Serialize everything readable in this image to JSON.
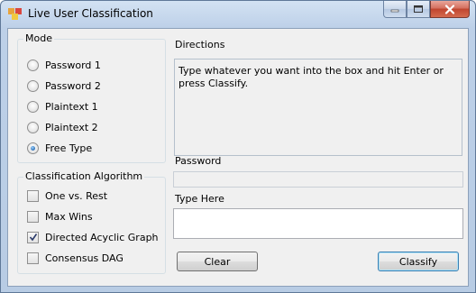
{
  "window": {
    "title": "Live User Classification",
    "title_icon": "app-icon",
    "caption_buttons": [
      "minimize",
      "maximize",
      "close"
    ]
  },
  "mode": {
    "heading": "Mode",
    "options": [
      {
        "label": "Password 1",
        "checked": false
      },
      {
        "label": "Password 2",
        "checked": false
      },
      {
        "label": "Plaintext 1",
        "checked": false
      },
      {
        "label": "Plaintext 2",
        "checked": false
      },
      {
        "label": "Free Type",
        "checked": true
      }
    ]
  },
  "algorithm": {
    "heading": "Classification Algorithm",
    "options": [
      {
        "label": "One vs. Rest",
        "checked": false
      },
      {
        "label": "Max Wins",
        "checked": false
      },
      {
        "label": "Directed Acyclic Graph",
        "checked": true
      },
      {
        "label": "Consensus DAG",
        "checked": false
      }
    ]
  },
  "directions": {
    "heading": "Directions",
    "text": "Type whatever you want into the box and hit Enter or press Classify."
  },
  "password": {
    "heading": "Password",
    "value": ""
  },
  "type_here": {
    "heading": "Type Here",
    "value": ""
  },
  "buttons": {
    "clear": "Clear",
    "classify": "Classify"
  }
}
